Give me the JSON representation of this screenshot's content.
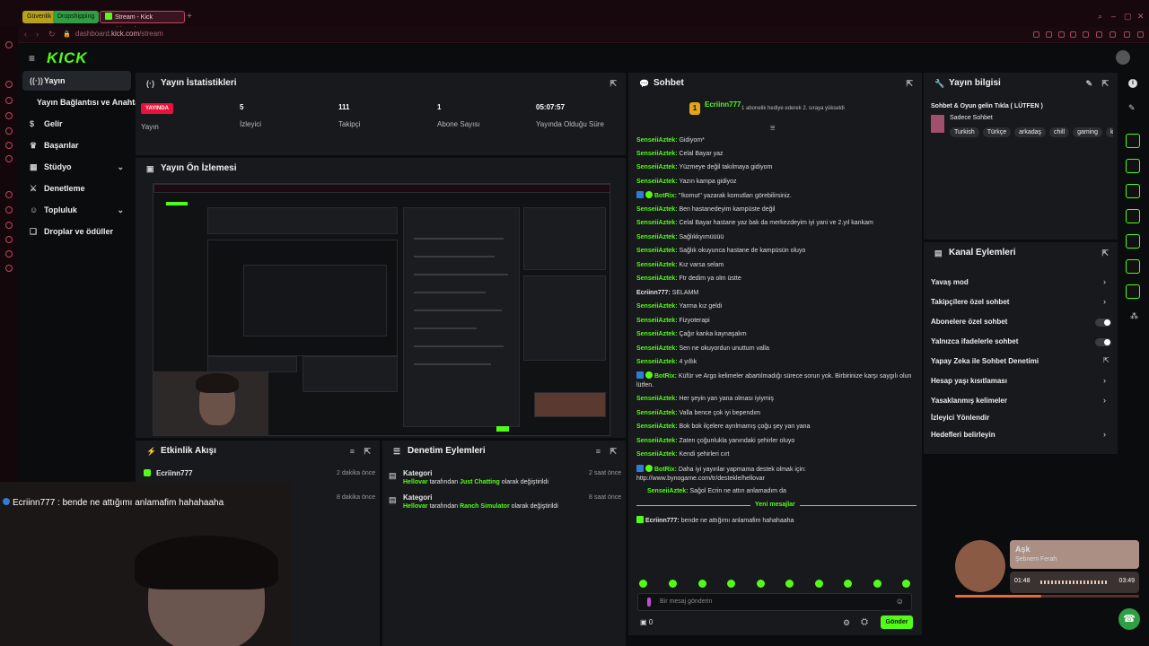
{
  "browser": {
    "tabs": [
      {
        "label": "Güvenlik"
      },
      {
        "label": "Dropshipping"
      },
      {
        "label": "Stream - Kick Dashboard"
      }
    ],
    "url_prefix": "dashboard.",
    "url_domain": "kick.com",
    "url_path": "/stream"
  },
  "brand": {
    "logo": "KICK",
    "accent": "#53fc18",
    "live_color": "#e9113c"
  },
  "sidebar": {
    "items": [
      {
        "label": "Yayın",
        "icon": "broadcast-icon",
        "active": true
      },
      {
        "label": "Yayın Bağlantısı ve Anahtarı",
        "icon": ""
      },
      {
        "label": "Gelir",
        "icon": "dollar-icon"
      },
      {
        "label": "Başarılar",
        "icon": "trophy-icon"
      },
      {
        "label": "Stüdyo",
        "icon": "studio-icon",
        "expandable": true
      },
      {
        "label": "Denetleme",
        "icon": "sword-icon"
      },
      {
        "label": "Topluluk",
        "icon": "community-icon",
        "expandable": true
      },
      {
        "label": "Droplar ve ödüller",
        "icon": "gift-icon"
      }
    ]
  },
  "stats": {
    "title": "Yayın İstatistikleri",
    "live_badge": "YAYINDA",
    "live_label": "Yayın",
    "viewers": "5",
    "viewers_label": "İzleyici",
    "followers": "111",
    "followers_label": "Takipçi",
    "subs": "1",
    "subs_label": "Abone Sayısı",
    "uptime": "05:07:57",
    "uptime_label": "Yayında Olduğu Süre"
  },
  "preview": {
    "title": "Yayın Ön İzlemesi"
  },
  "activity": {
    "title": "Etkinlik Akışı",
    "items": [
      {
        "user": "Ecriinn777",
        "time": "2 dakika önce"
      },
      {
        "user": "",
        "time": "8 dakika önce"
      }
    ]
  },
  "moderation": {
    "title": "Denetim Eylemleri",
    "items": [
      {
        "title": "Kategori",
        "time": "2 saat önce",
        "actor": "Hellovar",
        "mid": "tarafından",
        "category": "Just Chatting",
        "suffix": "olarak değiştirildi"
      },
      {
        "title": "Kategori",
        "time": "8 saat önce",
        "actor": "Hellovar",
        "mid": "tarafından",
        "category": "Ranch Simulator",
        "suffix": "olarak değiştirildi"
      }
    ]
  },
  "chat": {
    "title": "Sohbet",
    "pinned_user": "Ecriinn777",
    "pinned_rank": "1",
    "pinned_note": "1 abonelik hediye ederek 2. sıraya yükseldi",
    "messages": [
      {
        "user": "SenseiiAztek",
        "text": "Gidiyom*"
      },
      {
        "user": "SenseiiAztek",
        "text": "Celal Bayar yaz"
      },
      {
        "user": "SenseiiAztek",
        "text": "Yüzmeye değil takılmaya gidiyom"
      },
      {
        "user": "SenseiiAztek",
        "text": "Yazın kampa gidiyoz"
      },
      {
        "user": "BotRix",
        "text": "\"!komut\" yazarak komutları görebilirsiniz.",
        "bot": true
      },
      {
        "user": "SenseiiAztek",
        "text": "Ben hastanedeyim kampüste değil"
      },
      {
        "user": "SenseiiAztek",
        "text": "Celal Bayar hastane yaz bak da merkezdeyim iyi yani ve 2.yıl kankam"
      },
      {
        "user": "SenseiiAztek",
        "text": "Sağlıkkyımüüüü"
      },
      {
        "user": "SenseiiAztek",
        "text": "Sağlık okuyunca hastane de kampüsün oluyo"
      },
      {
        "user": "SenseiiAztek",
        "text": "Kız varsa selam"
      },
      {
        "user": "SenseiiAztek",
        "text": "Ftr dedim ya olm üstte"
      },
      {
        "user": "Ecriinn777",
        "text": "SELAMM",
        "self": true
      },
      {
        "user": "SenseiiAztek",
        "text": "Yarma kız geldi"
      },
      {
        "user": "SenseiiAztek",
        "text": "Fizyoterapi"
      },
      {
        "user": "SenseiiAztek",
        "text": "Çağır kanka kaynaşalım"
      },
      {
        "user": "SenseiiAztek",
        "text": "Sen ne okuyordun unuttum valla"
      },
      {
        "user": "SenseiiAztek",
        "text": "4 yıllık"
      },
      {
        "user": "BotRix",
        "text": "Küfür ve Argo kelimeler abartılmadığı sürece sorun yok. Birbirinize karşı saygılı olun lütfen.",
        "bot": true
      },
      {
        "user": "SenseiiAztek",
        "text": "Her şeyin yan yana olması iyiymiş"
      },
      {
        "user": "SenseiiAztek",
        "text": "Valla bence çok iyi bependım"
      },
      {
        "user": "SenseiiAztek",
        "text": "Bok bok ilçelere ayrılmamış çoğu şey yan yana"
      },
      {
        "user": "SenseiiAztek",
        "text": "Zaten çoğunlukla yanındaki şehirler oluyo"
      },
      {
        "user": "SenseiiAztek",
        "text": "Kendi şehirleri cırt"
      },
      {
        "user": "BotRix",
        "text": "Daha iyi yayınlar yapmama destek olmak için: http://www.bynogame.com/tr/destekle/hellovar",
        "bot": true
      },
      {
        "user": "SenseiiAztek",
        "text": "Sağol Ecrin ne attın anlamadım da"
      }
    ],
    "new_messages": "Yeni mesajlar",
    "last": {
      "user": "Ecriinn777",
      "text": "bende ne attığımı anlamafim hahahaaha"
    },
    "input_placeholder": "Bir mesaj gönderin",
    "send": "Gönder",
    "points": "0"
  },
  "stream_info": {
    "title": "Yayın bilgisi",
    "stream_title": "Sohbet & Oyun gelin Tıkla ( LÜTFEN )",
    "category": "Sadece Sohbet",
    "tags": [
      "Turkish",
      "Türkçe",
      "arkadaş",
      "chill",
      "gaming",
      "k"
    ]
  },
  "channel_actions": {
    "title": "Kanal Eylemleri",
    "items": [
      {
        "label": "Yavaş mod",
        "ctrl": "chevron"
      },
      {
        "label": "Takipçilere özel sohbet",
        "ctrl": "chevron"
      },
      {
        "label": "Abonelere özel sohbet",
        "ctrl": "toggle"
      },
      {
        "label": "Yalnızca ifadelerle sohbet",
        "ctrl": "toggle"
      },
      {
        "label": "Yapay Zeka ile Sohbet Denetimi",
        "ctrl": "ext"
      },
      {
        "label": "Hesap yaşı kısıtlaması",
        "ctrl": "chevron"
      },
      {
        "label": "Yasaklanmış kelimeler",
        "ctrl": "chevron"
      },
      {
        "label": "İzleyici Yönlendir",
        "ctrl": "none"
      },
      {
        "label": "Hedefleri belirleyin",
        "ctrl": "chevron"
      }
    ]
  },
  "overlay": {
    "caption_user": "Ecriinn777",
    "caption_text": ": bende ne attığımı anlamafim hahahaaha"
  },
  "music": {
    "title": "Aşk",
    "artist": "Şebnem Ferah",
    "elapsed": "01:48",
    "duration": "03:49",
    "progress": 0.47
  }
}
